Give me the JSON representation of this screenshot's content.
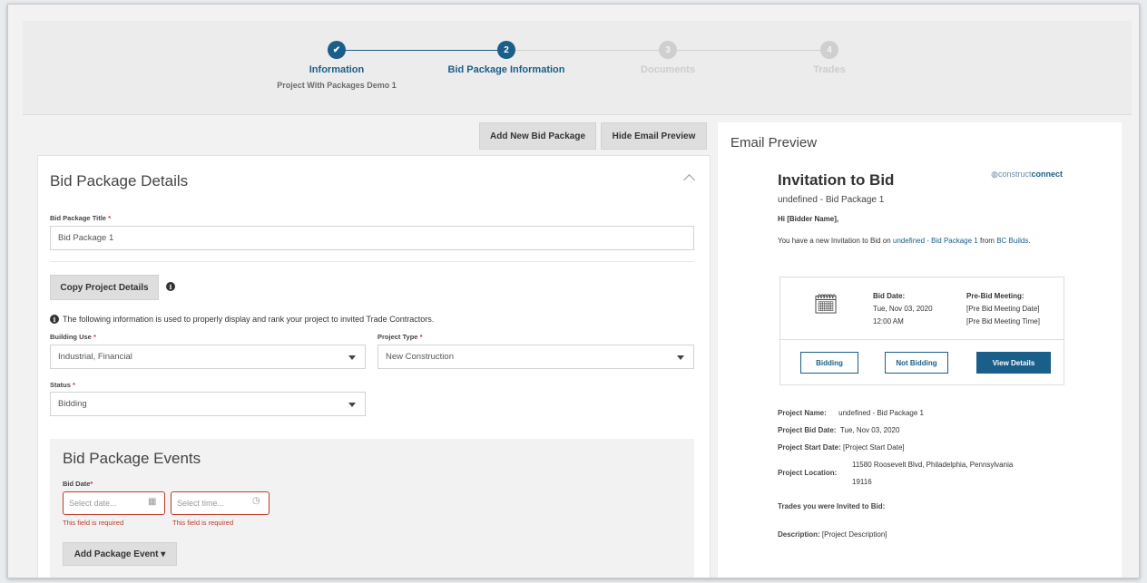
{
  "stepper": {
    "steps": [
      {
        "num": "✔",
        "title": "Information",
        "sub": "Project With Packages Demo 1",
        "state": "done"
      },
      {
        "num": "2",
        "title": "Bid Package Information",
        "sub": "",
        "state": "active"
      },
      {
        "num": "3",
        "title": "Documents",
        "sub": "",
        "state": "todo"
      },
      {
        "num": "4",
        "title": "Trades",
        "sub": "",
        "state": "todo"
      }
    ]
  },
  "toolbar": {
    "add_new_label": "Add New Bid Package",
    "hide_preview_label": "Hide Email Preview"
  },
  "details": {
    "title": "Bid Package Details",
    "title_label": "Bid Package Title",
    "title_value": "Bid Package 1",
    "copy_label": "Copy Project Details",
    "info_note": "The following information is used to properly display and rank your project to invited Trade Contractors.",
    "building_use_label": "Building Use",
    "building_use_value": "Industrial, Financial",
    "project_type_label": "Project Type",
    "project_type_value": "New Construction",
    "status_label": "Status",
    "status_value": "Bidding",
    "required_mark": "*"
  },
  "events": {
    "title": "Bid Package Events",
    "bid_date_label": "Bid Date",
    "date_placeholder": "Select date...",
    "time_placeholder": "Select time...",
    "required_error": "This field is required",
    "add_event_label": "Add Package Event ▾"
  },
  "preview": {
    "title": "Email Preview",
    "heading": "Invitation to Bid",
    "subheading": "undefined - Bid Package 1",
    "logo_light": "construct",
    "logo_bold": "connect",
    "greeting": "Hi [Bidder Name],",
    "intro_1": "You have a new Invitation to Bid on ",
    "intro_link": "undefined - Bid Package 1",
    "intro_2": " from ",
    "intro_link2": "BC Builds",
    "intro_end": ".",
    "bid_date_label": "Bid Date:",
    "bid_date": "Tue, Nov 03, 2020",
    "bid_time": "12:00 AM",
    "prebid_label": "Pre-Bid Meeting:",
    "prebid_date": "[Pre Bid Meeting Date]",
    "prebid_time": "[Pre Bid Meeting Time]",
    "btn_bidding": "Bidding",
    "btn_not_bidding": "Not Bidding",
    "btn_view": "View Details",
    "project_name_label": "Project Name:",
    "project_name": "undefined - Bid Package 1",
    "project_bid_date_label": "Project Bid Date:",
    "project_bid_date": "Tue, Nov 03, 2020",
    "project_start_label": "Project Start Date:",
    "project_start": "[Project Start Date]",
    "project_location_label": "Project Location:",
    "project_location_1": "11580 Roosevelt Blvd, Philadelphia, Pennsylvania",
    "project_location_2": "19116",
    "trades_label": "Trades you were Invited to Bid:",
    "description_label": "Description:",
    "description": "[Project Description]"
  }
}
